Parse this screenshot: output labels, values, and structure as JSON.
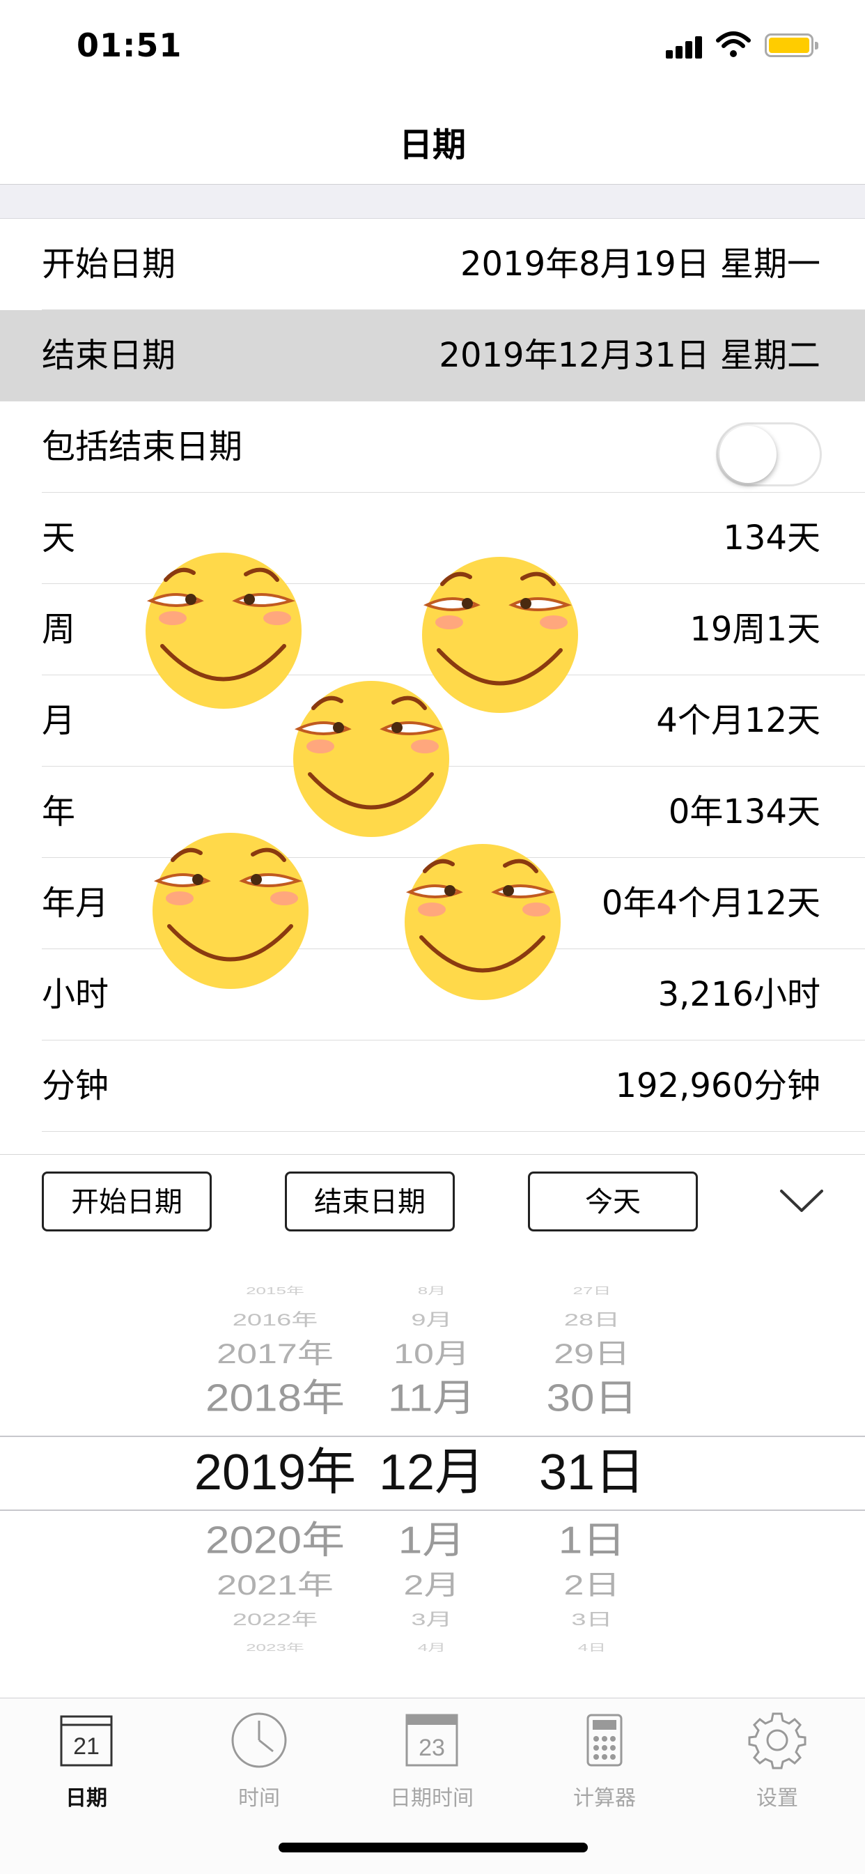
{
  "status_bar": {
    "time": "01:51"
  },
  "nav": {
    "title": "日期"
  },
  "rows": [
    {
      "label": "开始日期",
      "value": "2019年8月19日 星期一"
    },
    {
      "label": "结束日期",
      "value": "2019年12月31日 星期二"
    },
    {
      "label": "包括结束日期",
      "toggle_on": false
    },
    {
      "label": "天",
      "value": "134天"
    },
    {
      "label": "周",
      "value": "19周1天"
    },
    {
      "label": "月",
      "value": "4个月12天"
    },
    {
      "label": "年",
      "value": "0年134天"
    },
    {
      "label": "年月",
      "value": "0年4个月12天"
    },
    {
      "label": "小时",
      "value": "3,216小时"
    },
    {
      "label": "分钟",
      "value": "192,960分钟"
    }
  ],
  "buttons": {
    "start_date": "开始日期",
    "end_date": "结束日期",
    "today": "今天"
  },
  "picker": {
    "years": [
      "2015年",
      "2016年",
      "2017年",
      "2018年",
      "2019年",
      "2020年",
      "2021年",
      "2022年",
      "2023年"
    ],
    "months": [
      "8月",
      "9月",
      "10月",
      "11月",
      "12月",
      "1月",
      "2月",
      "3月",
      "4月"
    ],
    "days": [
      "27日",
      "28日",
      "29日",
      "30日",
      "31日",
      "1日",
      "2日",
      "3日",
      "4日"
    ],
    "selected_index": 4
  },
  "tabs": [
    {
      "label": "日期",
      "icon": "calendar-icon",
      "icon_text": "21",
      "active": true
    },
    {
      "label": "时间",
      "icon": "clock-icon",
      "active": false
    },
    {
      "label": "日期时间",
      "icon": "calendar-time-icon",
      "icon_text": "23",
      "active": false
    },
    {
      "label": "计算器",
      "icon": "calculator-icon",
      "active": false
    },
    {
      "label": "设置",
      "icon": "gear-icon",
      "active": false
    }
  ],
  "colors": {
    "battery": "#ffcc00",
    "selected_row": "#d8d8d8",
    "face": "#ffd94a"
  }
}
